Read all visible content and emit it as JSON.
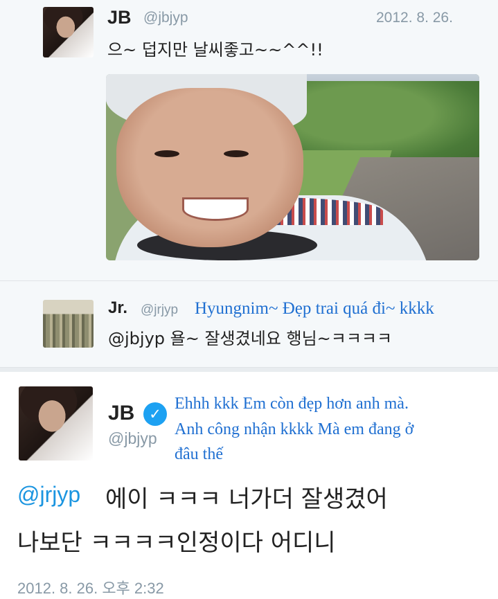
{
  "tweet1": {
    "name": "JB",
    "handle": "@jbjyp",
    "date": "2012. 8. 26.",
    "text": "으~ 덥지만 날씨좋고~~^^!!"
  },
  "tweet2": {
    "name": "Jr.",
    "handle": "@jrjyp",
    "translation": "Hyungnim~ Đẹp trai quá đi~ kkkk",
    "text": "@jbjyp 욜~ 잘생겼네요 행님~ㅋㅋㅋㅋ"
  },
  "tweet3": {
    "name": "JB",
    "handle": "@jbjyp",
    "verified_glyph": "✓",
    "translation_line1": "Ehhh kkk Em còn đẹp hơn anh mà.",
    "translation_line2": "Anh công nhận kkkk Mà em đang ở",
    "translation_line3": "đâu thế",
    "mention": "@jrjyp",
    "text_line1": "에이 ㅋㅋㅋ 너가더 잘생겼어",
    "text_line2": "나보단 ㅋㅋㅋㅋ인정이다  어디니",
    "timestamp": "2012. 8. 26. 오후 2:32"
  },
  "colors": {
    "link": "#1b95e0",
    "translation": "#1f6fd1",
    "muted": "#8899a6",
    "verified": "#1da1f2"
  },
  "icons": [
    "verified-badge-icon"
  ]
}
